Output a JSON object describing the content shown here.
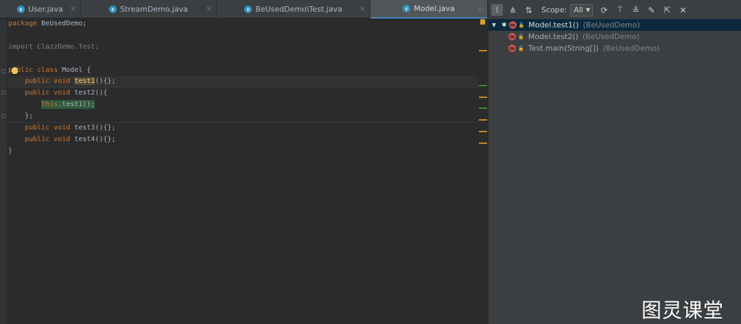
{
  "editor": {
    "tabs": [
      {
        "label": "User.java",
        "icon": "java-class-icon",
        "active": false
      },
      {
        "label": "StreamDemo.java",
        "icon": "java-class-icon",
        "active": false
      },
      {
        "label": "BeUsedDemo\\Test.java",
        "icon": "java-class-icon",
        "active": false
      },
      {
        "label": "Model.java",
        "icon": "java-class-icon",
        "active": true
      }
    ],
    "code": {
      "l1_kw": "package",
      "l1_rest": " BeUsedDemo;",
      "l3": "import ClazzDemo.Test;",
      "l5_kw": "public class",
      "l5_rest": " Model {",
      "l6_kw": "public void",
      "l6_fn": "test1",
      "l6_rest": "(){};",
      "l7_kw": "public void",
      "l7_rest": " test2(){",
      "l8_this": "this",
      "l8_rest": ".test1();",
      "l9": "};",
      "l10_kw": "public void",
      "l10_rest": " test3(){};",
      "l11_kw": "public void",
      "l11_rest": " test4(){};",
      "l12": "}"
    }
  },
  "hierarchy": {
    "toolbar": {
      "scope_label": "Scope:",
      "scope_value": "All",
      "icons": [
        "caller-hierarchy-icon",
        "callee-hierarchy-icon",
        "sort-alphabetically-icon",
        "refresh-icon",
        "autoscroll-icon",
        "expand-all-icon",
        "pin-icon",
        "export-icon",
        "close-icon"
      ]
    },
    "tree": [
      {
        "label": "Model.test1()",
        "package": "(BeUsedDemo)",
        "selected": true
      },
      {
        "label": "Model.test2()",
        "package": "(BeUsedDemo)",
        "selected": false
      },
      {
        "label": "Test.main(String[])",
        "package": "(BeUsedDemo)",
        "selected": false
      }
    ]
  },
  "watermark": "图灵课堂",
  "colors": {
    "editor_bg": "#2b2b2b",
    "keyword": "#cc7832",
    "function": "#ffc66d",
    "text": "#a9b7c6",
    "panel_bg": "#3c3f41",
    "selection": "#0d293e"
  }
}
